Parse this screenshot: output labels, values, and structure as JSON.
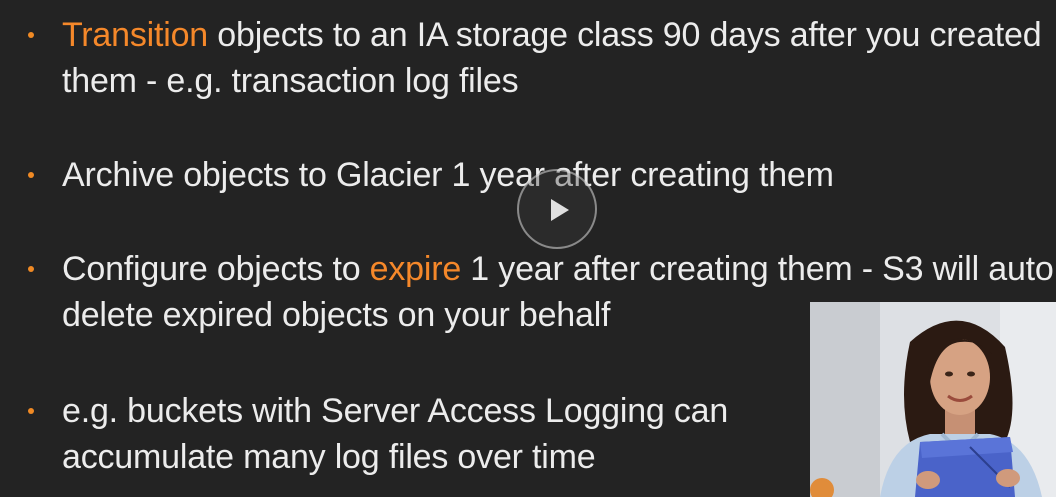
{
  "slide": {
    "bullets": [
      {
        "highlight": "Transition",
        "text_after": " objects to an IA storage class 90 days after you created them - e.g. transaction log files"
      },
      {
        "text": "Archive objects to Glacier 1 year after creating them"
      },
      {
        "text_before": "Configure objects to ",
        "highlight": "expire",
        "text_after": " 1 year after creating them - S3 will auto delete expired objects on your behalf"
      },
      {
        "text": "e.g. buckets with Server Access Logging can accumulate many log files over time"
      }
    ]
  },
  "player": {
    "play_icon": "play-icon"
  },
  "presenter": {
    "image": "presenter-video-thumbnail"
  },
  "colors": {
    "background": "#232323",
    "text": "#ececec",
    "accent": "#f5882a"
  }
}
